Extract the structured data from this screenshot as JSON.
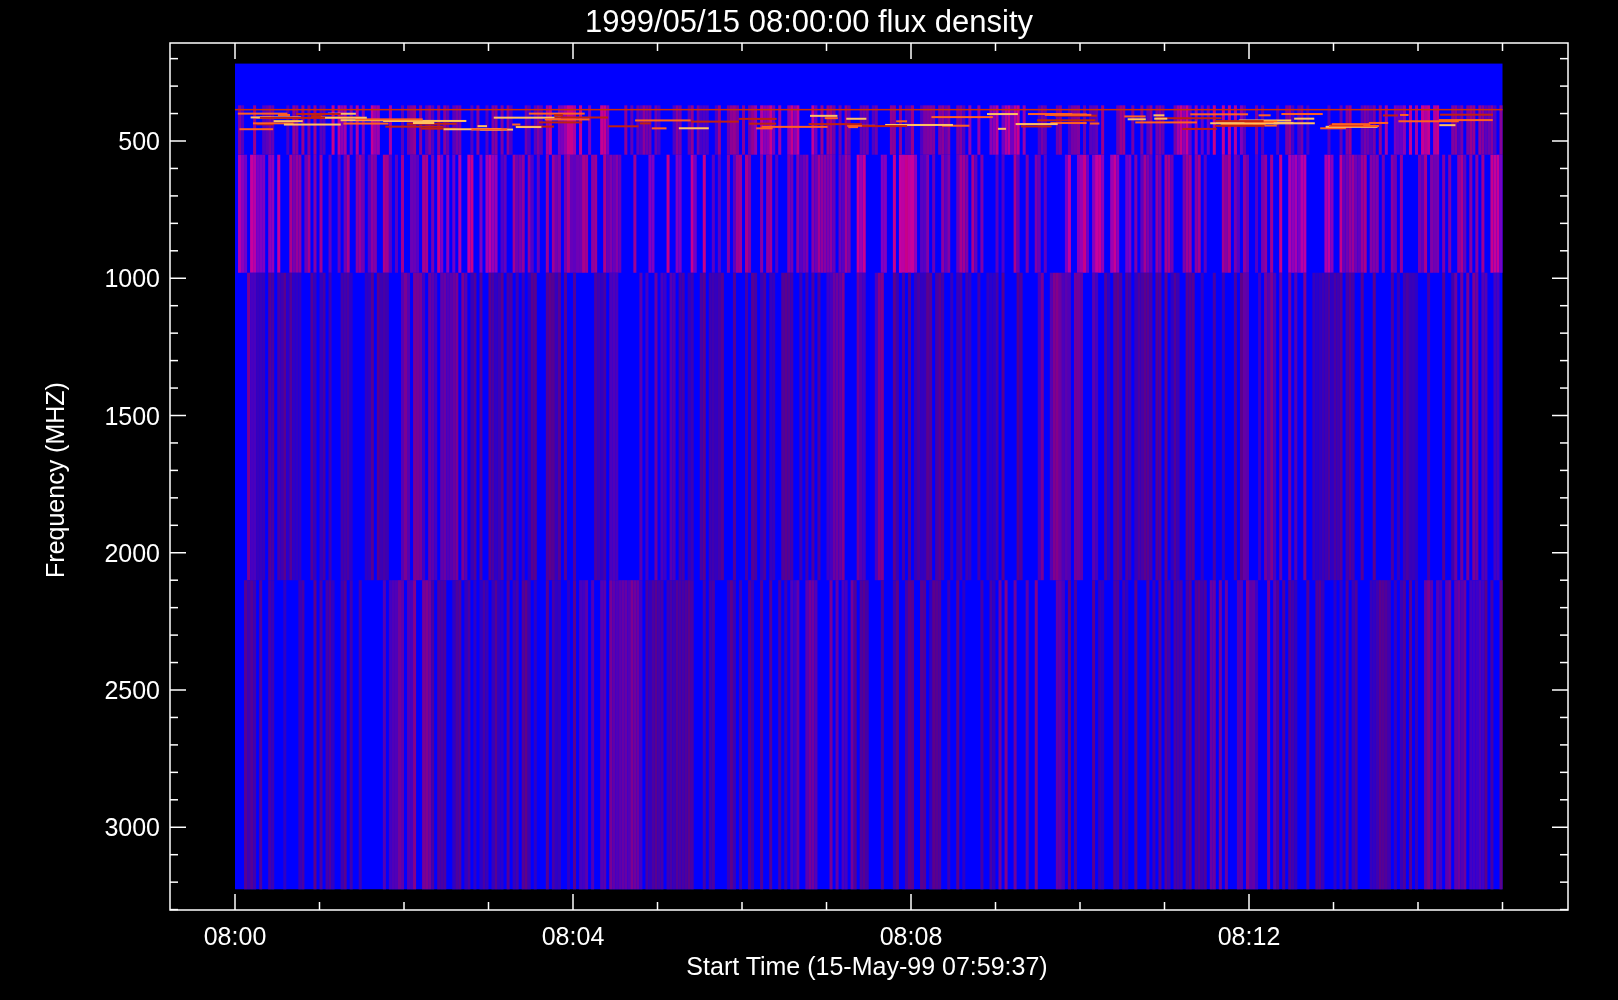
{
  "plot": {
    "title": "1999/05/15 08:00:00 flux density",
    "y_axis": {
      "label": "Frequency (MHZ)",
      "ticks": [
        "500",
        "1000",
        "1500",
        "2000",
        "2500",
        "3000"
      ]
    },
    "x_axis": {
      "label": "Start Time (15-May-99 07:59:37)",
      "ticks": [
        "08:00",
        "08:04",
        "08:08",
        "08:12"
      ]
    }
  }
}
